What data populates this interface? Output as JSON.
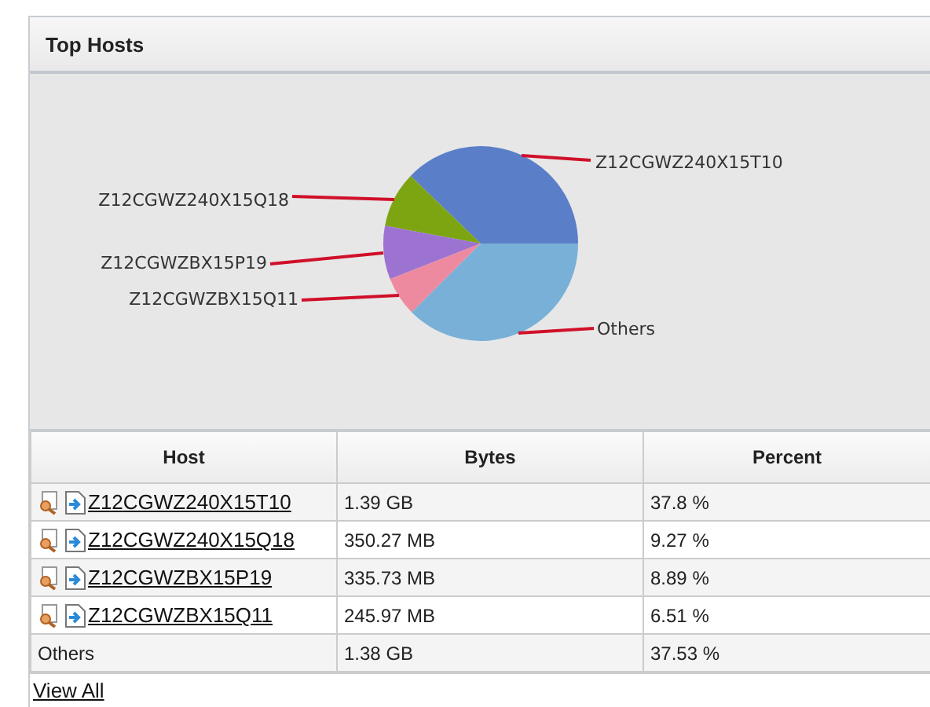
{
  "panel": {
    "title": "Top Hosts"
  },
  "chart": {
    "chart_data": {
      "type": "pie",
      "categories": [
        "Z12CGWZ240X15T10",
        "Z12CGWZ240X15Q18",
        "Z12CGWZBX15P19",
        "Z12CGWZBX15Q11",
        "Others"
      ],
      "series": [
        {
          "values": [
            37.8,
            9.27,
            8.89,
            6.51,
            37.53
          ]
        }
      ],
      "colors": [
        "#5a7fc8",
        "#7da512",
        "#9c73d0",
        "#ee8aa0",
        "#78b0d8"
      ]
    }
  },
  "table": {
    "columns": [
      "Host",
      "Bytes",
      "Percent"
    ],
    "rows": [
      {
        "kind": "host",
        "host": "Z12CGWZ240X15T10",
        "bytes": "1.39 GB",
        "percent": "37.8 %"
      },
      {
        "kind": "host",
        "host": "Z12CGWZ240X15Q18",
        "bytes": "350.27 MB",
        "percent": "9.27 %"
      },
      {
        "kind": "host",
        "host": "Z12CGWZBX15P19",
        "bytes": "335.73 MB",
        "percent": "8.89 %"
      },
      {
        "kind": "host",
        "host": "Z12CGWZBX15Q11",
        "bytes": "245.97 MB",
        "percent": "6.51 %"
      },
      {
        "kind": "other",
        "host": "Others",
        "bytes": "1.38 GB",
        "percent": "37.53 %"
      }
    ]
  },
  "view_all": "View All"
}
